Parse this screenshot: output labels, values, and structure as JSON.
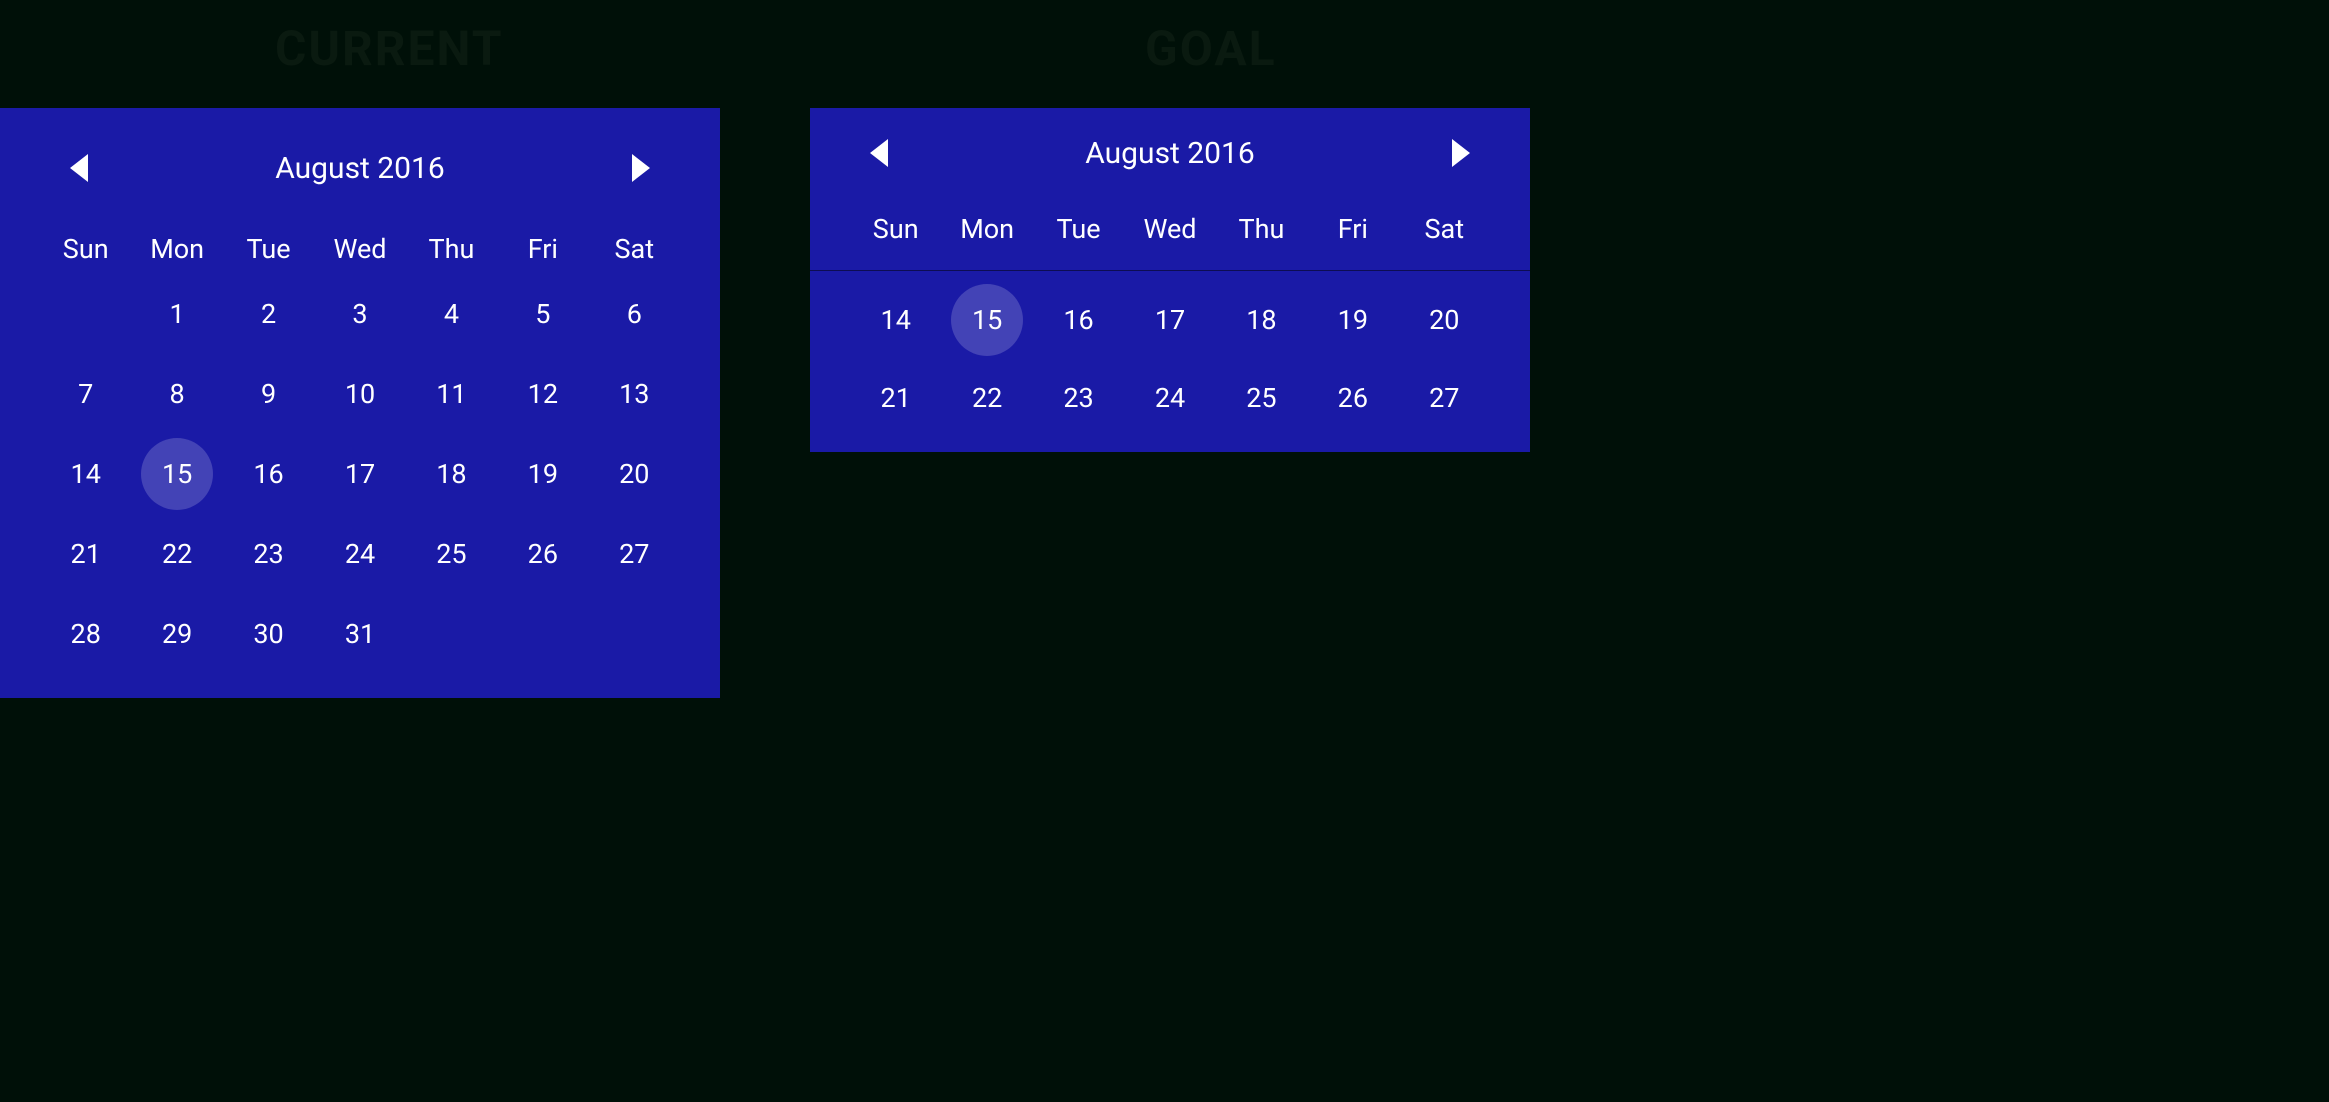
{
  "labels": {
    "current": "CURRENT",
    "goal": "GOAL"
  },
  "weekdays": [
    "Sun",
    "Mon",
    "Tue",
    "Wed",
    "Thu",
    "Fri",
    "Sat"
  ],
  "current_calendar": {
    "title": "August 2016",
    "selected_day": 15,
    "leading_blanks": 1,
    "days": [
      1,
      2,
      3,
      4,
      5,
      6,
      7,
      8,
      9,
      10,
      11,
      12,
      13,
      14,
      15,
      16,
      17,
      18,
      19,
      20,
      21,
      22,
      23,
      24,
      25,
      26,
      27,
      28,
      29,
      30,
      31
    ]
  },
  "goal_calendar": {
    "title": "August 2016",
    "selected_day": 15,
    "rows": [
      [
        14,
        15,
        16,
        17,
        18,
        19,
        20
      ],
      [
        21,
        22,
        23,
        24,
        25,
        26,
        27
      ]
    ]
  }
}
